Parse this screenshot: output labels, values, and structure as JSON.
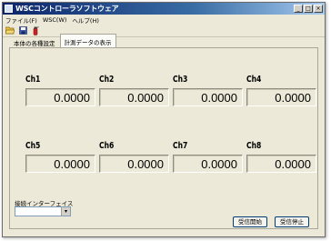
{
  "window": {
    "title": "WSCコントローラソフトウェア",
    "min_label": "_",
    "max_label": "□",
    "close_label": "×"
  },
  "menu": [
    "ファイル(F)",
    "WSC(W)",
    "ヘルプ(H)"
  ],
  "toolbar": {
    "icons": [
      "folder-open-icon",
      "save-icon",
      "fire-extinguisher-icon"
    ]
  },
  "tabs": [
    {
      "label": "本体の各種設定",
      "active": false
    },
    {
      "label": "計測データの表示",
      "active": true
    }
  ],
  "channels": [
    {
      "label": "Ch1",
      "value": "0.0000"
    },
    {
      "label": "Ch2",
      "value": "0.0000"
    },
    {
      "label": "Ch3",
      "value": "0.0000"
    },
    {
      "label": "Ch4",
      "value": "0.0000"
    },
    {
      "label": "Ch5",
      "value": "0.0000"
    },
    {
      "label": "Ch6",
      "value": "0.0000"
    },
    {
      "label": "Ch7",
      "value": "0.0000"
    },
    {
      "label": "Ch8",
      "value": "0.0000"
    }
  ],
  "interface": {
    "label": "接続インターフェイス",
    "selected": "",
    "arrow": "▾"
  },
  "buttons": {
    "start": "受信開始",
    "stop": "受信停止"
  },
  "colors": {
    "titlebar": "#0a246a",
    "window_bg": "#ece9d8"
  }
}
